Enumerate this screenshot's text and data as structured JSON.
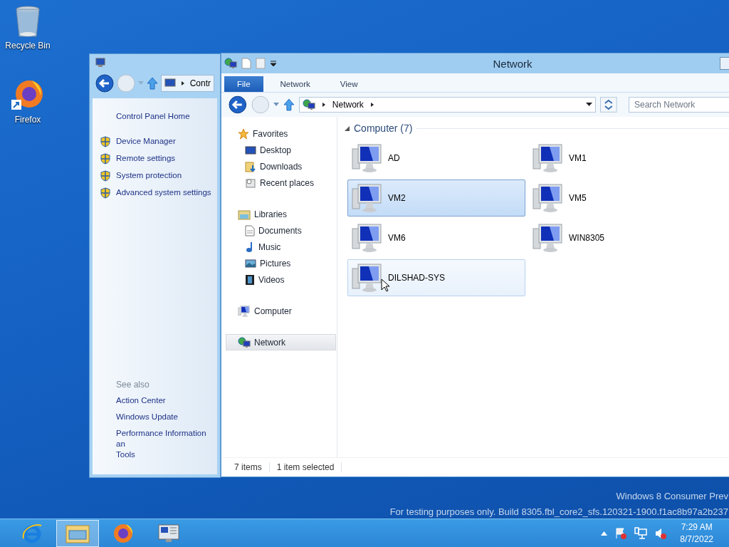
{
  "desktop": {
    "icons": [
      {
        "kind": "bin",
        "label": "Recycle Bin"
      },
      {
        "kind": "firefox",
        "label": "Firefox"
      }
    ],
    "watermark": [
      "Windows 8 Consumer Prev",
      "For testing purposes only. Build 8305.fbl_core2_sfs.120321-1900.f1ac8b97a2b237"
    ]
  },
  "control_panel": {
    "address": "Contr",
    "home": "Control Panel Home",
    "tasks": [
      "Device Manager",
      "Remote settings",
      "System protection",
      "Advanced system settings"
    ],
    "see_also_title": "See also",
    "see_also": [
      "Action Center",
      "Windows Update",
      "Performance Information an\nTools"
    ]
  },
  "explorer": {
    "title": "Network",
    "tabs": [
      {
        "label": "File",
        "selected": true
      },
      {
        "label": "Network",
        "selected": false
      },
      {
        "label": "View",
        "selected": false
      }
    ],
    "address": [
      "Network"
    ],
    "search": {
      "placeholder": "Search Network"
    },
    "nav": [
      {
        "kind": "star",
        "label": "Favorites",
        "selected": false,
        "children": [
          {
            "kind": "desktop",
            "label": "Desktop",
            "selected": false
          },
          {
            "kind": "download",
            "label": "Downloads",
            "selected": false
          },
          {
            "kind": "recent",
            "label": "Recent places",
            "selected": false
          }
        ]
      },
      {
        "kind": "library",
        "label": "Libraries",
        "selected": false,
        "children": [
          {
            "kind": "document",
            "label": "Documents",
            "selected": false
          },
          {
            "kind": "music",
            "label": "Music",
            "selected": false
          },
          {
            "kind": "picture",
            "label": "Pictures",
            "selected": false
          },
          {
            "kind": "video",
            "label": "Videos",
            "selected": false
          }
        ]
      },
      {
        "kind": "computer",
        "label": "Computer",
        "selected": false
      },
      {
        "kind": "network",
        "label": "Network",
        "selected": true
      }
    ],
    "group": {
      "label": "Computer (7)",
      "expanded": true
    },
    "items": [
      {
        "label": "AD",
        "selected": false,
        "hovered": false
      },
      {
        "label": "VM1",
        "selected": false,
        "hovered": false
      },
      {
        "label": "VM2",
        "selected": true,
        "hovered": false
      },
      {
        "label": "VM5",
        "selected": false,
        "hovered": false
      },
      {
        "label": "VM6",
        "selected": false,
        "hovered": false
      },
      {
        "label": "WIN8305",
        "selected": false,
        "hovered": false
      },
      {
        "label": "DILSHAD-SYS",
        "selected": false,
        "hovered": true
      }
    ],
    "status": [
      "7 items",
      "1 item selected"
    ]
  },
  "taskbar": {
    "apps": [
      {
        "kind": "ie",
        "active": false
      },
      {
        "kind": "explorer",
        "active": true
      },
      {
        "kind": "firefox",
        "active": false
      },
      {
        "kind": "system",
        "active": false
      }
    ],
    "time": "7:29 AM",
    "date": "8/7/2022"
  }
}
